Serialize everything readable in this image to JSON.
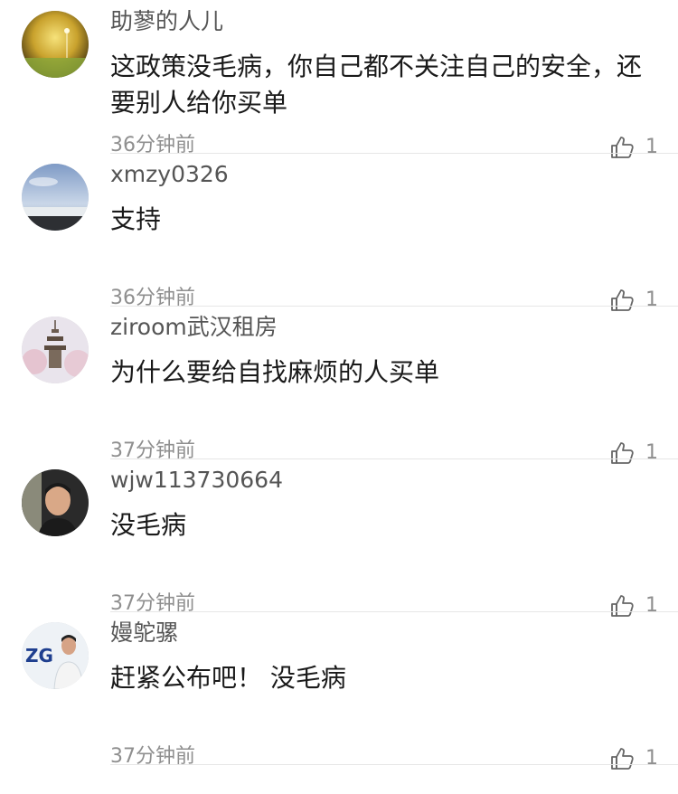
{
  "comments": [
    {
      "username": "助蓼的人儿",
      "content": "这政策没毛病，你自己都不关注自己的安全，还要别人给你买单",
      "time": "36分钟前",
      "likes": "1",
      "avatar": "sunset-field-avatar"
    },
    {
      "username": "xmzy0326",
      "content": "支持",
      "time": "36分钟前",
      "likes": "1",
      "avatar": "sky-landscape-avatar"
    },
    {
      "username": "ziroom武汉租房",
      "content": "为什么要给自找麻烦的人买单",
      "time": "37分钟前",
      "likes": "1",
      "avatar": "pagoda-blossom-avatar"
    },
    {
      "username": "wjw113730664",
      "content": "没毛病",
      "time": "37分钟前",
      "likes": "1",
      "avatar": "man-portrait-avatar"
    },
    {
      "username": "嫚鸵骡",
      "content": "赶紧公布吧！  没毛病",
      "time": "37分钟前",
      "likes": "1",
      "avatar": "logo-person-avatar"
    }
  ],
  "icons": {
    "like": "thumbs-up-icon"
  },
  "colors": {
    "username": "#555555",
    "content": "#1a1a1a",
    "meta": "#8f8f8f",
    "divider": "#e6e6e6"
  }
}
